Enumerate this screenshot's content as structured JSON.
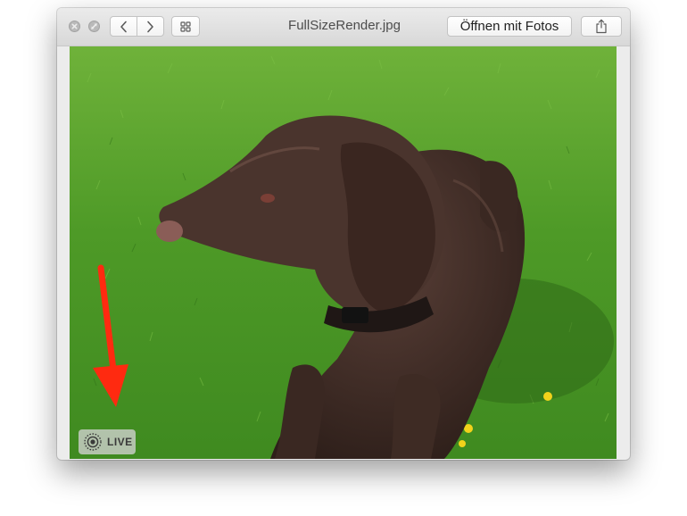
{
  "window": {
    "title": "FullSizeRender.jpg",
    "open_button_label": "Öffnen mit Fotos"
  },
  "icons": {
    "close": "close-icon",
    "fullscreen": "fullscreen-icon",
    "back": "chevron-left-icon",
    "forward": "chevron-right-icon",
    "index_sheet": "grid-icon",
    "share": "share-icon",
    "live": "live-photo-icon",
    "annotation": "red-arrow-icon"
  },
  "image": {
    "subject": "brown dog lying on grass",
    "badge_label": "LIVE"
  },
  "colors": {
    "annotation_arrow": "#ff2a10",
    "grass": "#4f9a28",
    "dog": "#3e2a24"
  }
}
